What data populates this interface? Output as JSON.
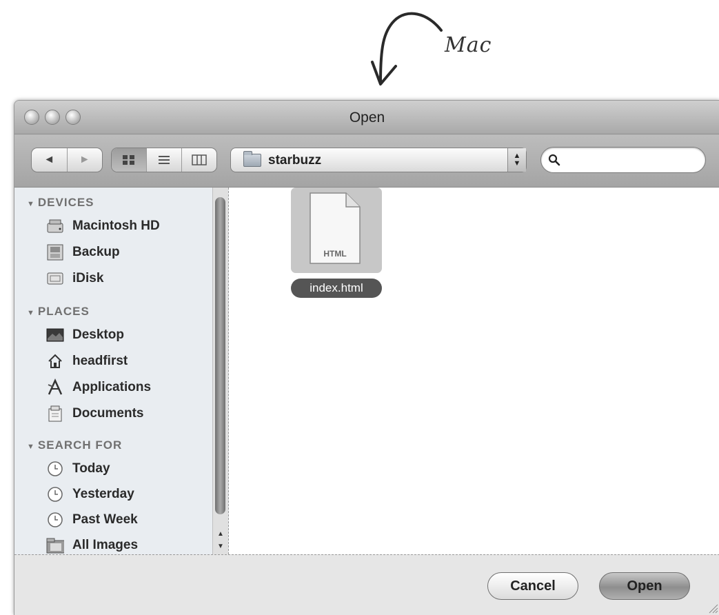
{
  "annotation": {
    "label": "Mac"
  },
  "window": {
    "title": "Open"
  },
  "toolbar": {
    "back_glyph": "◄",
    "forward_glyph": "►",
    "views": [
      "icon-view",
      "list-view",
      "column-view"
    ],
    "path_popup": {
      "label": "starbuzz"
    },
    "search": {
      "value": "",
      "placeholder": ""
    }
  },
  "sidebar": {
    "devices_heading": "DEVICES",
    "devices": [
      {
        "label": "Macintosh HD",
        "icon": "hard-drive-icon"
      },
      {
        "label": "Backup",
        "icon": "disk-icon"
      },
      {
        "label": "iDisk",
        "icon": "idisk-icon"
      }
    ],
    "places_heading": "PLACES",
    "places": [
      {
        "label": "Desktop",
        "icon": "desktop-icon"
      },
      {
        "label": "headfirst",
        "icon": "home-icon"
      },
      {
        "label": "Applications",
        "icon": "applications-icon"
      },
      {
        "label": "Documents",
        "icon": "documents-icon"
      }
    ],
    "search_heading": "SEARCH FOR",
    "search_for": [
      {
        "label": "Today",
        "icon": "clock-icon"
      },
      {
        "label": "Yesterday",
        "icon": "clock-icon"
      },
      {
        "label": "Past Week",
        "icon": "clock-icon"
      },
      {
        "label": "All Images",
        "icon": "images-folder-icon"
      }
    ]
  },
  "browser": {
    "files": [
      {
        "name": "index.html",
        "badge": "HTML",
        "selected": true
      }
    ]
  },
  "buttons": {
    "cancel": "Cancel",
    "open": "Open"
  },
  "colors": {
    "sidebar_bg": "#e9edf1",
    "selection": "#555555",
    "titlebar": "#b8b8b8"
  }
}
